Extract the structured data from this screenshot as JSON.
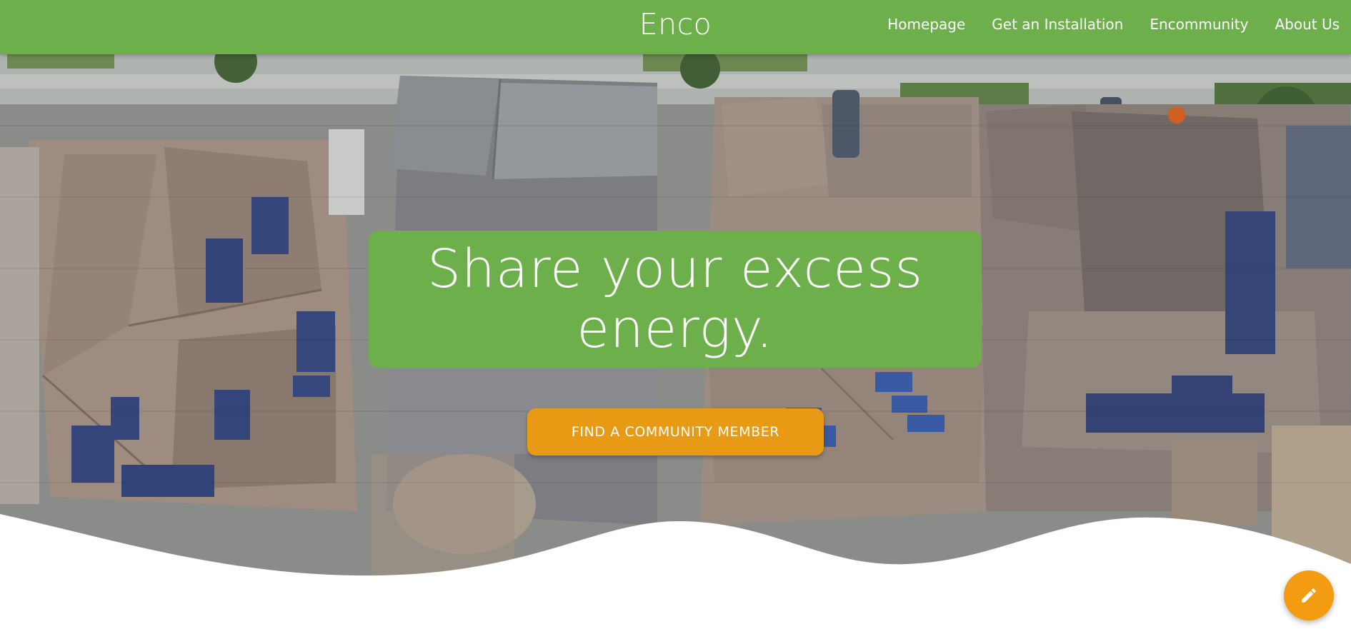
{
  "header": {
    "brand": "Enco",
    "nav": [
      {
        "label": "Homepage"
      },
      {
        "label": "Get an Installation"
      },
      {
        "label": "Encommunity"
      },
      {
        "label": "About Us"
      }
    ]
  },
  "hero": {
    "headline": "Share your excess energy.",
    "cta_label": "FIND A COMMUNITY MEMBER"
  },
  "fab": {
    "icon": "pencil-icon"
  },
  "colors": {
    "brand_green": "#6db04b",
    "accent_orange": "#e89a14",
    "fab_orange": "#f39c12"
  }
}
